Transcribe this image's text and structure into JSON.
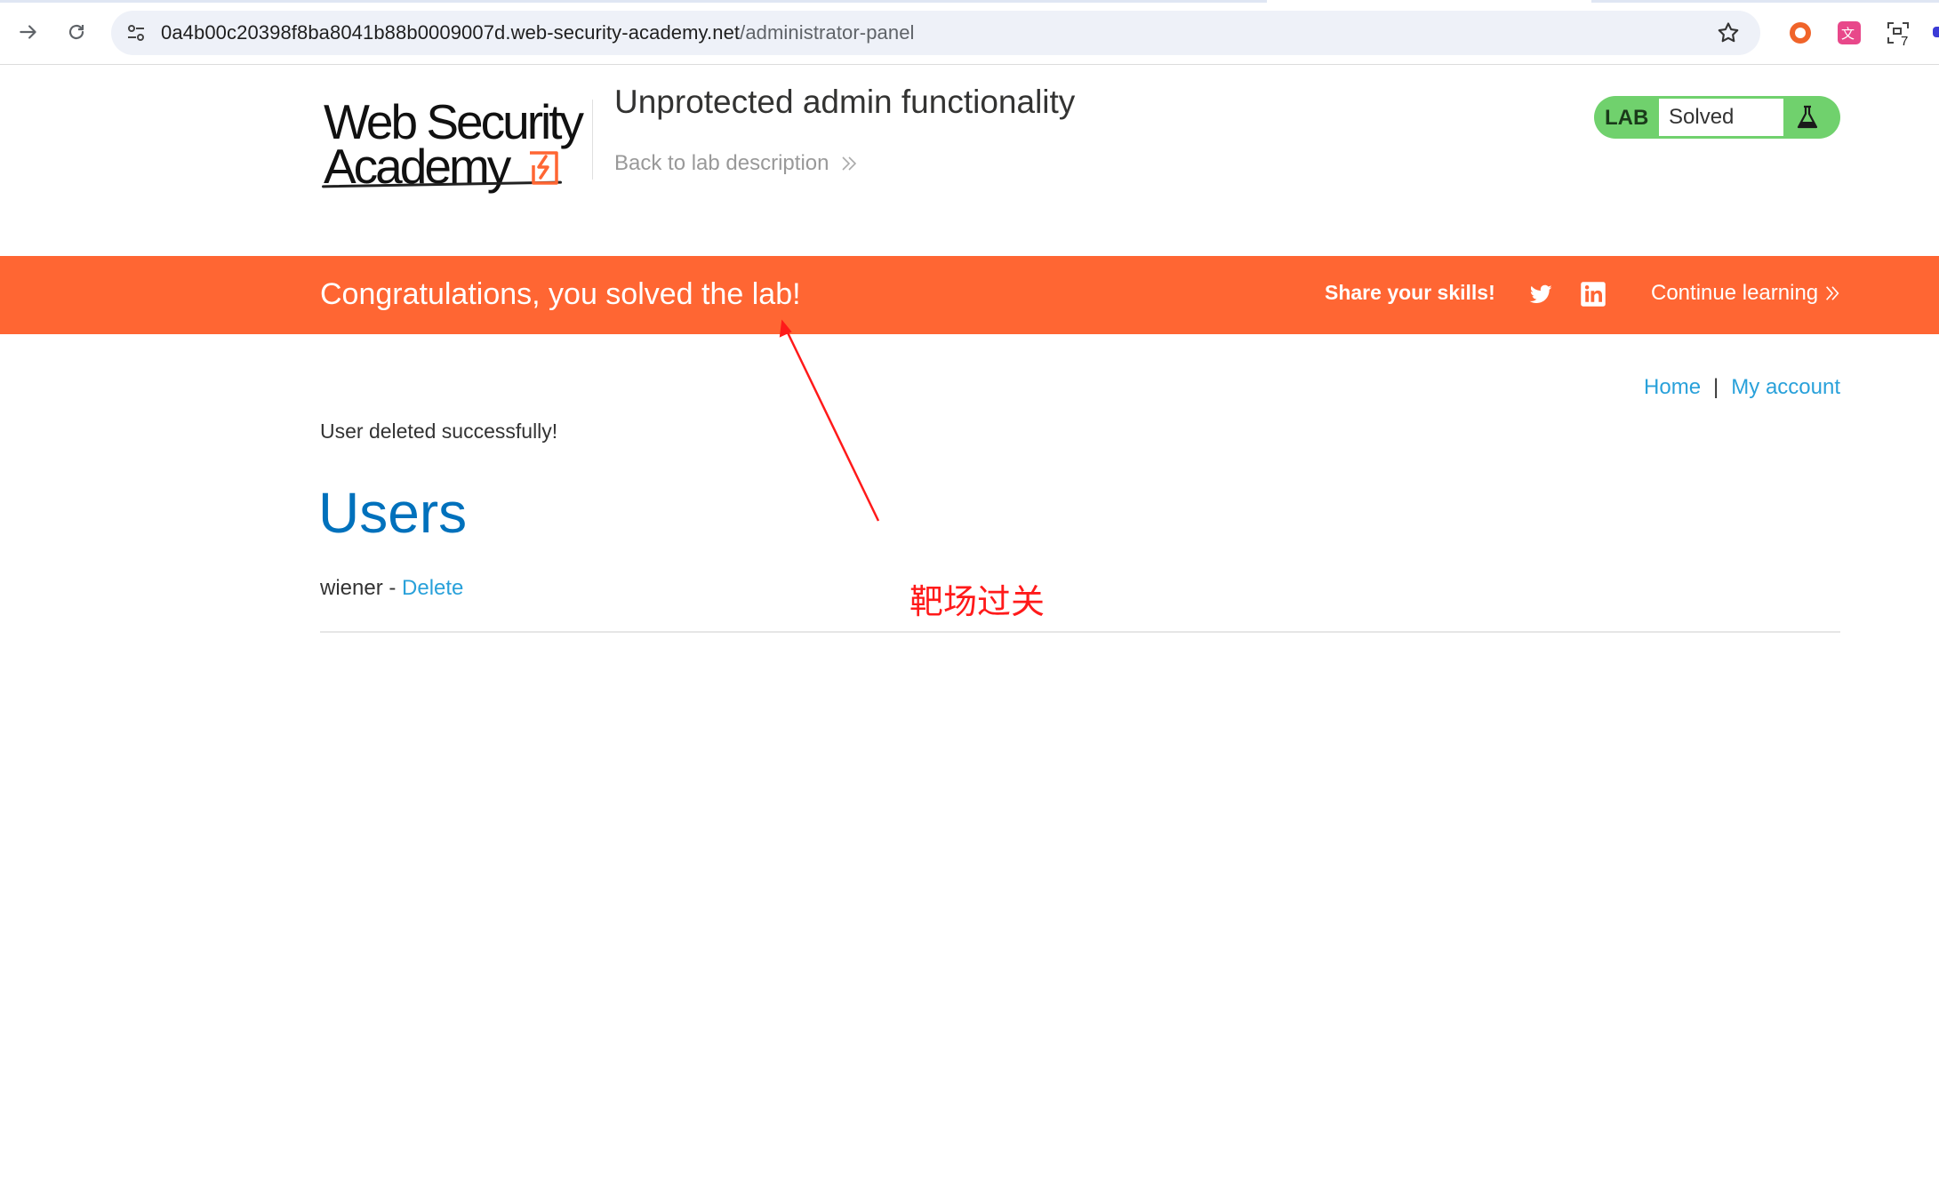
{
  "browser": {
    "url_host": "0a4b00c20398f8ba8041b88b0009007d.web-security-academy.net",
    "url_path": "/administrator-panel",
    "extension_badge": "7"
  },
  "header": {
    "logo_line1": "Web Security",
    "logo_line2": "Academy",
    "lab_title": "Unprotected admin functionality",
    "back_link": "Back to lab description",
    "lab_badge_label": "LAB",
    "lab_status": "Solved",
    "lab_status_color": "#70d16d"
  },
  "banner": {
    "message": "Congratulations, you solved the lab!",
    "share_label": "Share your skills!",
    "continue_label": "Continue learning",
    "background": "#ff6633"
  },
  "nav": {
    "home": "Home",
    "separator": "|",
    "my_account": "My account"
  },
  "content": {
    "result_message": "User deleted successfully!",
    "users_heading": "Users",
    "users": [
      {
        "name": "wiener",
        "separator": " - ",
        "action": "Delete"
      }
    ]
  },
  "annotation": {
    "text": "靶场过关",
    "color": "#ff1a1a"
  }
}
